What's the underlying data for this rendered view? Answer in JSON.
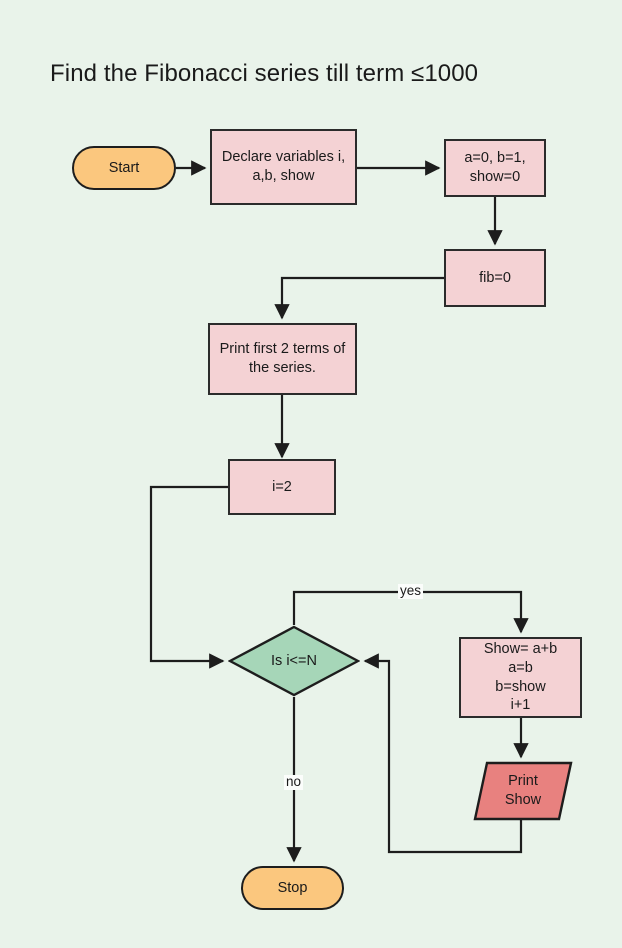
{
  "diagram": {
    "title": "Find the Fibonacci series till term ≤1000",
    "background_color": "#e9f3ea",
    "colors": {
      "process_fill": "#f4d2d4",
      "terminator_fill": "#fbc77e",
      "decision_fill": "#a6d6b8",
      "io_fill": "#e8817f",
      "stroke": "#2b2b2b"
    },
    "nodes": {
      "start": {
        "label": "Start",
        "shape": "terminator"
      },
      "declare": {
        "label": "Declare variables i,\na,b, show",
        "shape": "process"
      },
      "init": {
        "label": "a=0, b=1,\nshow=0",
        "shape": "process"
      },
      "fib": {
        "label": "fib=0",
        "shape": "process"
      },
      "print_first": {
        "label": "Print first 2 terms of\nthe series.",
        "shape": "process"
      },
      "i_set": {
        "label": "i=2",
        "shape": "process"
      },
      "decision": {
        "label": "Is i<=N",
        "shape": "decision"
      },
      "compute": {
        "label": "Show= a+b\na=b\nb=show\ni+1",
        "shape": "process"
      },
      "print_show": {
        "label": "Print\nShow",
        "shape": "input-output"
      },
      "stop": {
        "label": "Stop",
        "shape": "terminator"
      }
    },
    "edge_labels": {
      "yes": "yes",
      "no": "no"
    }
  }
}
